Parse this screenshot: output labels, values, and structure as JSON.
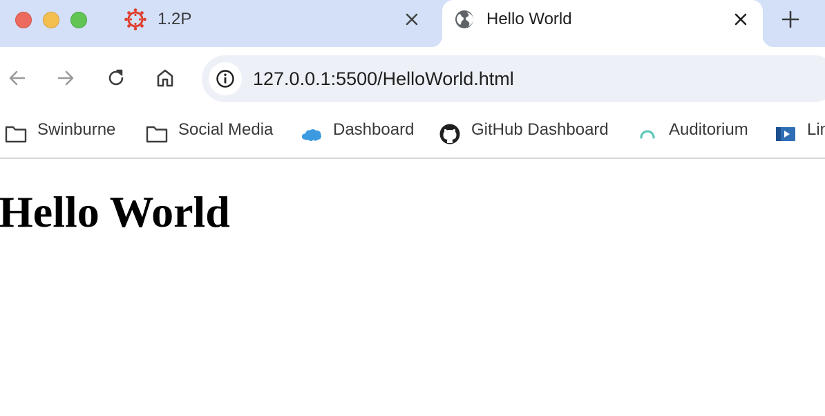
{
  "window": {
    "title": "Hello World"
  },
  "tabs": [
    {
      "title": "1.2P",
      "favicon": "canvas-lms-icon",
      "active": false
    },
    {
      "title": "Hello World",
      "favicon": "globe-icon",
      "active": true
    }
  ],
  "toolbar": {
    "back_icon": "arrow-left-icon",
    "forward_icon": "arrow-right-icon",
    "reload_icon": "reload-icon",
    "home_icon": "home-icon",
    "url": "127.0.0.1:5500/HelloWorld.html",
    "site_info_icon": "info-icon"
  },
  "bookmarks": [
    {
      "label": "Swinburne",
      "icon": "folder-icon"
    },
    {
      "label": "Social Media",
      "icon": "folder-icon"
    },
    {
      "label": "Dashboard",
      "icon": "salesforce-cloud-icon"
    },
    {
      "label": "GitHub Dashboard",
      "icon": "github-icon"
    },
    {
      "label": "Auditorium",
      "icon": "auditorium-arc-icon"
    },
    {
      "label": "Lin",
      "icon": "video-icon"
    }
  ],
  "page": {
    "heading": "Hello World"
  },
  "colors": {
    "tabstrip_bg": "#d3e0f8",
    "omnibox_bg": "#edf0f7",
    "traffic_close": "#ec6a5e",
    "traffic_minimize": "#f4bf4f",
    "traffic_maximize": "#61c554",
    "canvas_red": "#e03e2d",
    "salesforce_blue": "#3c9ae0",
    "auditorium_teal": "#5ec8b8"
  }
}
